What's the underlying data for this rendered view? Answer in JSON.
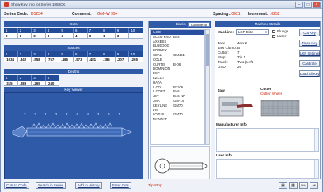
{
  "window": {
    "title": "Show Key Info for Series 1958CK",
    "minimize": "–",
    "maximize": "□",
    "close": "×"
  },
  "info": {
    "series_label": "Series Code:",
    "series_value": "D1234",
    "comment_label": "Comment:",
    "comment_value": "GM+W 99+",
    "spacing_label": "Spacing:",
    "spacing_value": ".0921",
    "increment_label": "Increment:",
    "increment_value": ".0252"
  },
  "cuts": {
    "title": "Cuts",
    "index": [
      "1",
      "2",
      "3",
      "4",
      "5",
      "6",
      "7",
      "8",
      "9",
      "10"
    ],
    "values": [
      "3",
      "1",
      "3",
      "3",
      "4",
      "4",
      "3",
      "1",
      "3",
      ""
    ]
  },
  "spaces": {
    "title": "Spaces",
    "index": [
      "1",
      "2",
      "3",
      "4",
      "5",
      "6",
      "7",
      "8",
      "9",
      "10"
    ],
    "values": [
      ".1034",
      ".342",
      ".558",
      ".757",
      ".465",
      ".573",
      ".481",
      ".385",
      ".207",
      ".265"
    ]
  },
  "depths": {
    "title": "Depths",
    "index": [
      "1",
      "2",
      "3",
      "4"
    ],
    "values": [
      ".315",
      ".289",
      ".265",
      ".240"
    ]
  },
  "key_viewer": {
    "title": "Key Viewer",
    "cut_digits": "3 3 1 3 3 4 4 3 3 1"
  },
  "blanks": {
    "tabs": [
      "Blanks",
      "Comments"
    ],
    "active_tab": "Comments",
    "rows": [
      {
        "name": "ILCO",
        "code": ""
      },
      {
        "name": "ACEM KND",
        "code": "B44"
      },
      {
        "name": "AXXESS",
        "code": ""
      },
      {
        "name": "BLUEDOG",
        "code": ""
      },
      {
        "name": "BORKEY",
        "code": ""
      },
      {
        "name": "CEAL",
        "code": "GM45B"
      },
      {
        "name": "COLE",
        "code": ""
      },
      {
        "name": "CURTIS",
        "code": "B-08"
      },
      {
        "name": "DOMINION",
        "code": ""
      },
      {
        "name": "ESP",
        "code": ""
      },
      {
        "name": "EZCUT",
        "code": ""
      },
      {
        "name": "HATA",
        "code": ""
      },
      {
        "name": "ILCO",
        "code": "P1106"
      },
      {
        "name": "ILCOEZ",
        "code": "B46"
      },
      {
        "name": "JET",
        "code": "B46-NP"
      },
      {
        "name": "JMA",
        "code": "GM-14"
      },
      {
        "name": "KEYLINE",
        "code": "GM70"
      },
      {
        "name": "KIS",
        "code": ""
      },
      {
        "name": "LOTUS",
        "code": "GM70"
      },
      {
        "name": "MANNAT",
        "code": ""
      }
    ]
  },
  "machine": {
    "title": "Machine Details",
    "machine_label": "Machine:",
    "machine_value": "LKP Elite",
    "plunge_label": "Plunge",
    "laser_label": "Laser",
    "details": [
      {
        "label": "Jaw:",
        "value": "Jaw 2"
      },
      {
        "label": "Jaw Clamp:",
        "value": "B"
      },
      {
        "label": "Cutter:",
        "value": "7"
      },
      {
        "label": "Stop:",
        "value": "Tip 1"
      },
      {
        "label": "Track:",
        "value": "Two (Left)"
      },
      {
        "label": "DSD:",
        "value": "26"
      }
    ],
    "buttons": [
      "Cut Key",
      "Trace Key",
      "LKP Settings",
      "Calibrate",
      "Load All Key"
    ],
    "jaw_label": "Jaw",
    "cutter_label": "Cutter",
    "cutter_value": "Cutter Wheel",
    "manufacturer_info_label": "Manufacturer Info",
    "user_info_label": "User Info"
  },
  "bottom": {
    "buttons": [
      "Cuts to Code",
      "Search in Series",
      "Add to History",
      "Enter Cuts"
    ],
    "tip": "Tip Stop",
    "icons": [
      "print-icon",
      "calculator-icon",
      "mm",
      "exit-icon"
    ],
    "mm_label": "MM"
  },
  "colors": {
    "accent": "#2e5aa8",
    "alert": "#cc2200"
  }
}
